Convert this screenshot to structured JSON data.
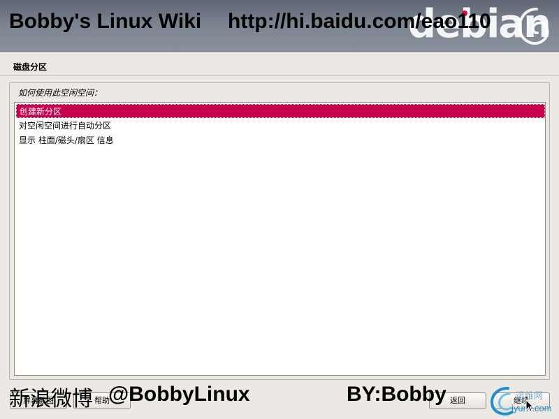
{
  "watermark": {
    "title": "Bobby's Linux Wiki",
    "url": "http://hi.baidu.com/eao110",
    "weibo": "新浪微博",
    "weibo_handle": "@BobbyLinux",
    "author": "BY:Bobby",
    "site_cn": "运维网",
    "site_en": "iyunv.com"
  },
  "header": {
    "logo_text": "debian",
    "logo_dot_color": "#d70751",
    "swirl_icon": "debian-swirl-icon"
  },
  "page": {
    "title": "磁盘分区",
    "question": "如何使用此空闲空间："
  },
  "options": [
    {
      "label": "创建新分区",
      "selected": true
    },
    {
      "label": "对空闲空间进行自动分区",
      "selected": false
    },
    {
      "label": "显示 柱面/磁头/扇区 信息",
      "selected": false
    }
  ],
  "buttons": {
    "screenshot": "屏幕截图",
    "help": "帮助",
    "back": "返回",
    "continue": "继续"
  },
  "colors": {
    "selection": "#c7004c",
    "background": "#ece9e4"
  }
}
